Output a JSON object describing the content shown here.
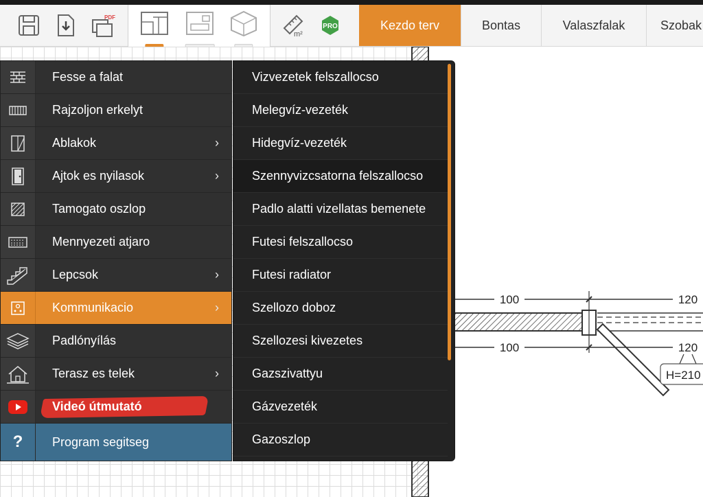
{
  "toolbar": {
    "icons": [
      "save-icon",
      "import-icon",
      "pdf-export-icon",
      "area-m2-icon",
      "pro-badge"
    ],
    "area_label": "m²",
    "pro_label": "PRO",
    "pdf_label": "PDF"
  },
  "views": [
    {
      "label": "2D",
      "active": true
    },
    {
      "label": "Falak",
      "active": false
    },
    {
      "label": "3D",
      "active": false
    }
  ],
  "tabs": [
    {
      "label": "Kezdo terv",
      "active": true
    },
    {
      "label": "Bontas",
      "active": false
    },
    {
      "label": "Valaszfalak",
      "active": false
    },
    {
      "label": "Szobak",
      "active": false
    }
  ],
  "menu": {
    "items": [
      {
        "label": "Fesse a falat",
        "icon": "brick-wall-icon",
        "submenu": false
      },
      {
        "label": "Rajzoljon erkelyt",
        "icon": "balcony-icon",
        "submenu": false
      },
      {
        "label": "Ablakok",
        "icon": "window-icon",
        "submenu": true
      },
      {
        "label": "Ajtok es nyilasok",
        "icon": "door-icon",
        "submenu": true
      },
      {
        "label": "Tamogato oszlop",
        "icon": "column-icon",
        "submenu": false
      },
      {
        "label": "Mennyezeti atjaro",
        "icon": "ceiling-opening-icon",
        "submenu": false
      },
      {
        "label": "Lepcsok",
        "icon": "stairs-icon",
        "submenu": true
      },
      {
        "label": "Kommunikacio",
        "icon": "utilities-icon",
        "submenu": true,
        "active": true
      },
      {
        "label": "Padlónyílás",
        "icon": "floor-opening-icon",
        "submenu": false
      },
      {
        "label": "Terasz es telek",
        "icon": "house-plot-icon",
        "submenu": true
      },
      {
        "label": "Videó útmutató",
        "icon": "youtube-icon",
        "submenu": false
      },
      {
        "label": "Program segitseg",
        "icon": "question-icon",
        "submenu": false
      }
    ],
    "chevron": "›",
    "help_glyph": "?"
  },
  "submenu": {
    "items": [
      "Vizvezetek felszallocso",
      "Melegvíz-vezeték",
      "Hidegvíz-vezeték",
      "Szennyvizcsatorna felszallocso",
      "Padlo alatti vizellatas bemenete",
      "Futesi felszallocso",
      "Futesi radiator",
      "Szellozo doboz",
      "Szellozesi kivezetes",
      "Gazszivattyu",
      "Gázvezeték",
      "Gazoszlop"
    ],
    "hover_index": 3
  },
  "plan": {
    "dim_top_a": "100",
    "dim_top_b": "120",
    "dim_bottom_a": "100",
    "dim_bottom_b": "120",
    "height_label": "H=210"
  },
  "colors": {
    "accent": "#e38a2c",
    "menu_bg": "#303030",
    "submenu_bg": "#232323",
    "help_bg": "#3d6e8e",
    "video_brush": "#d9332b"
  }
}
